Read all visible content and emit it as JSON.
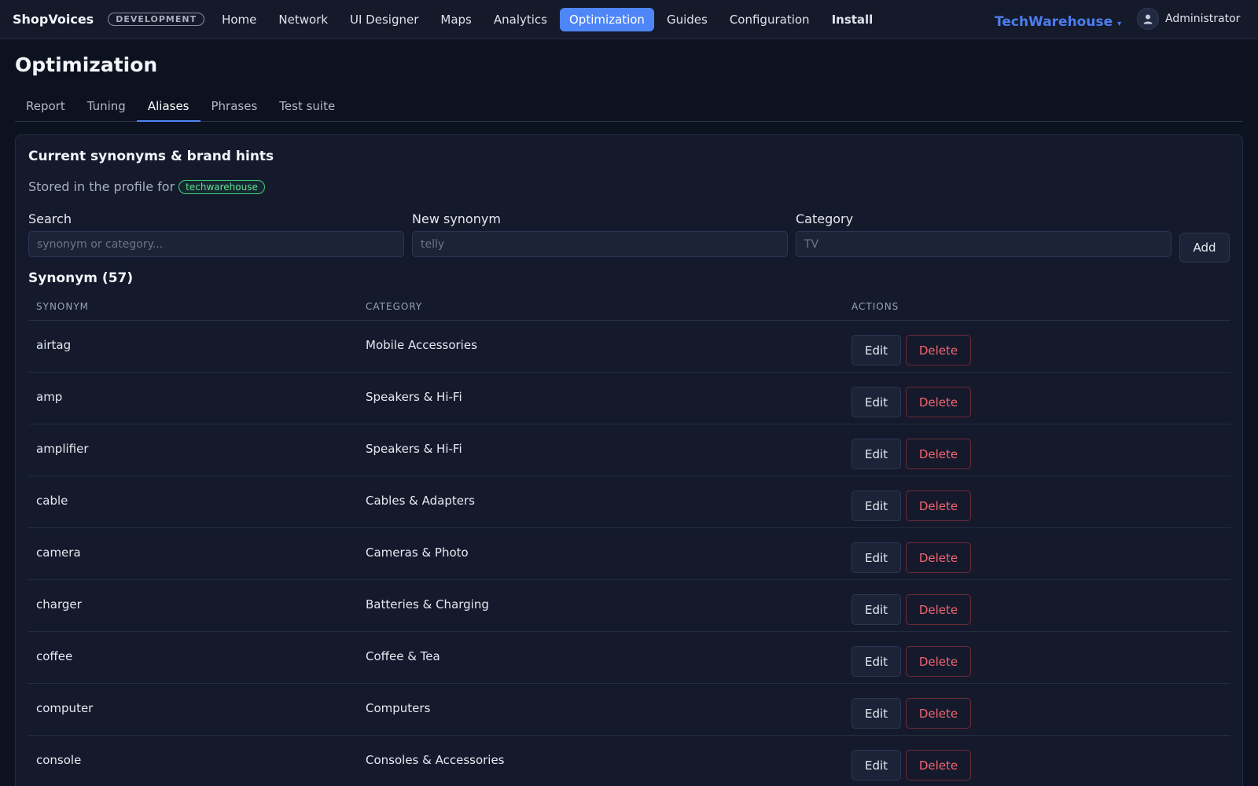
{
  "topbar": {
    "brand": "ShopVoices",
    "env_badge": "DEVELOPMENT",
    "nav": [
      {
        "label": "Home"
      },
      {
        "label": "Network"
      },
      {
        "label": "UI Designer"
      },
      {
        "label": "Maps"
      },
      {
        "label": "Analytics"
      },
      {
        "label": "Optimization",
        "active": true
      },
      {
        "label": "Guides"
      },
      {
        "label": "Configuration"
      },
      {
        "label": "Install",
        "bold": true
      }
    ],
    "store": "TechWarehouse",
    "caret": "▾",
    "user": "Administrator"
  },
  "page": {
    "title": "Optimization",
    "tabs": [
      {
        "label": "Report"
      },
      {
        "label": "Tuning"
      },
      {
        "label": "Aliases",
        "active": true
      },
      {
        "label": "Phrases"
      },
      {
        "label": "Test suite"
      }
    ]
  },
  "card": {
    "title": "Current synonyms & brand hints",
    "stored_text": "Stored in the profile for",
    "profile": "techwarehouse",
    "search": {
      "label": "Search",
      "placeholder": "synonym or category..."
    },
    "new_synonym": {
      "label": "New synonym",
      "placeholder": "telly"
    },
    "category": {
      "label": "Category",
      "placeholder": "TV"
    },
    "add_label": "Add",
    "list_title": "Synonym (57)"
  },
  "table": {
    "headers": {
      "synonym": "SYNONYM",
      "category": "CATEGORY",
      "actions": "ACTIONS"
    },
    "edit_label": "Edit",
    "delete_label": "Delete",
    "rows": [
      {
        "synonym": "airtag",
        "category": "Mobile Accessories"
      },
      {
        "synonym": "amp",
        "category": "Speakers & Hi-Fi"
      },
      {
        "synonym": "amplifier",
        "category": "Speakers & Hi-Fi"
      },
      {
        "synonym": "cable",
        "category": "Cables & Adapters"
      },
      {
        "synonym": "camera",
        "category": "Cameras & Photo"
      },
      {
        "synonym": "charger",
        "category": "Batteries & Charging"
      },
      {
        "synonym": "coffee",
        "category": "Coffee & Tea"
      },
      {
        "synonym": "computer",
        "category": "Computers"
      },
      {
        "synonym": "console",
        "category": "Consoles & Accessories"
      }
    ]
  },
  "colors": {
    "accent": "#4f86f7",
    "store": "#4b7df0",
    "danger": "#f2646f",
    "profile_badge": "#5fe092"
  }
}
